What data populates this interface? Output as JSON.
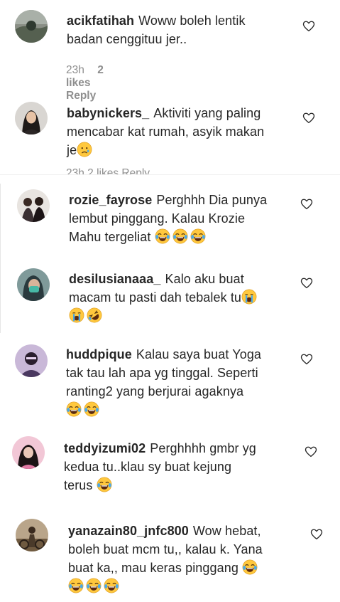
{
  "comments": [
    {
      "username": "acikfatihah",
      "line1": "Woww boleh lentik",
      "line2": "badan cenggituu jer..",
      "time": "23h",
      "likes": "2 likes",
      "reply": "Reply"
    },
    {
      "username": "babynickers_",
      "line1": "Aktiviti yang paling",
      "line2": "mencabar kat rumah, asyik makan",
      "line3": "je"
    },
    {
      "username": "rozie_fayrose",
      "line1": "Perghhh Dia punya",
      "line2": "lembut pinggang. Kalau Krozie",
      "line3": "Mahu tergeliat"
    },
    {
      "username": "desilusianaaa_",
      "line1": "Kalo aku buat",
      "line2": "macam tu pasti dah tebalek tu"
    },
    {
      "username": "huddpique",
      "line1": "Kalau saya buat Yoga",
      "line2": "tak tau lah apa yg tinggal. Seperti",
      "line3": "ranting2 yang berjurai agaknya"
    },
    {
      "username": "teddyizumi02",
      "line1": "Perghhhh gmbr yg",
      "line2": "kedua tu..klau sy buat kejung",
      "line3": "terus"
    },
    {
      "username": "yanazain80_jnfc800",
      "line1": "Wow hebat,",
      "line2": "boleh buat mcm tu,, kalau k. Yana",
      "line3": "buat ka,, mau keras pinggang"
    }
  ],
  "cut_meta": "23h   2 likes   Reply",
  "icons": {
    "like": "heart-outline-icon",
    "crying_face": "crying-face-emoji",
    "tears_of_joy": "tears-of-joy-emoji",
    "rofl": "rolling-laughing-emoji",
    "sad_face": "sad-face-emoji"
  },
  "colors": {
    "text": "#262626",
    "meta": "#8e8e8e",
    "emoji_yellow": "#ffc83d",
    "tear_blue": "#4aa8e8"
  }
}
